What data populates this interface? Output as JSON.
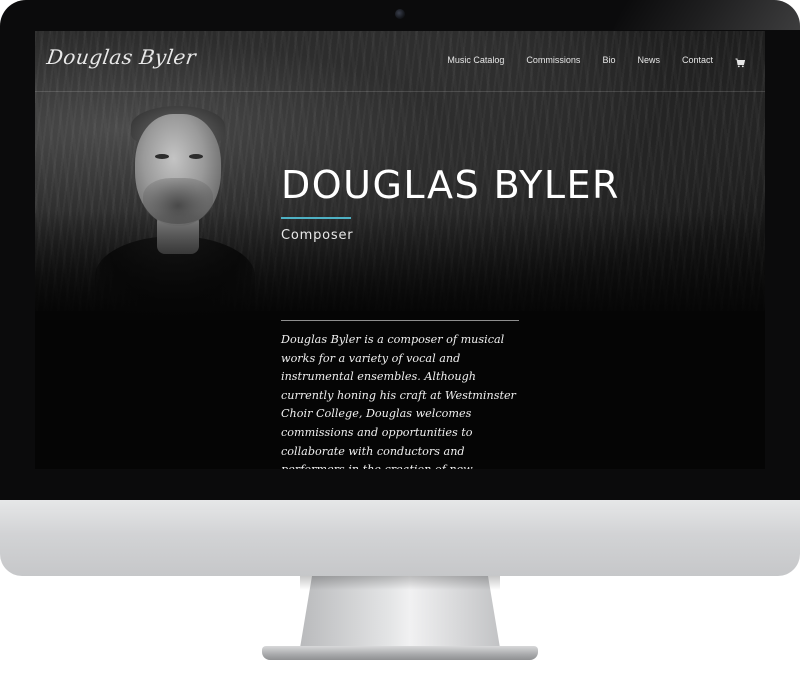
{
  "site": {
    "logo_text": "Douglas Byler"
  },
  "nav": {
    "items": [
      {
        "label": "Music Catalog",
        "name": "nav-music-catalog"
      },
      {
        "label": "Commissions",
        "name": "nav-commissions"
      },
      {
        "label": "Bio",
        "name": "nav-bio"
      },
      {
        "label": "News",
        "name": "nav-news"
      },
      {
        "label": "Contact",
        "name": "nav-contact"
      }
    ],
    "cart_icon": "shopping-cart-icon"
  },
  "hero": {
    "title": "DOUGLAS BYLER",
    "subtitle": "Composer"
  },
  "bio": {
    "text": "Douglas Byler is a composer of musical works for a variety of vocal and instrumental ensembles. Although currently honing his craft at Westminster Choir College, Douglas welcomes commissions and opportunities to collaborate with conductors and performers in the creation of new"
  },
  "colors": {
    "accent": "#4eb1c4",
    "background": "#050505",
    "text": "#ffffff"
  }
}
